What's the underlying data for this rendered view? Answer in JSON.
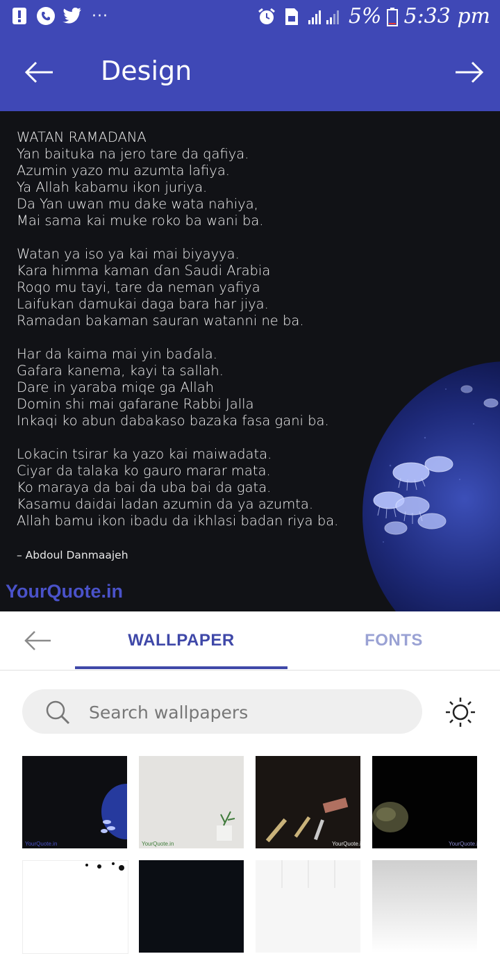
{
  "status_bar": {
    "battery_percent": "5%",
    "time": "5:33 pm",
    "overflow": "···"
  },
  "app_bar": {
    "title": "Design"
  },
  "quote": {
    "title": "WATAN RAMADANA",
    "stanzas": [
      [
        "Yan baituka na jero tare da qafiya.",
        "Azumin yazo mu azumta lafiya.",
        "Ya Allah kabamu ikon juriya.",
        "Da Yan uwan mu dake wata nahiya,",
        "Mai sama kai muke roko ba wani ba."
      ],
      [
        "Watan ya iso ya kai mai biyayya.",
        "Kara himma kaman ɗan Saudi Arabia",
        "Roqo mu tayi, tare da neman yafiya",
        "Laifukan damukai daga bara har jiya.",
        "Ramadan bakaman sauran watanni ne ba."
      ],
      [
        "Har da kaima mai yin baɗala.",
        "Gafara kanema, kayi ta sallah.",
        "Dare in yaraba miqe ga Allah",
        "Domin shi mai gafarane Rabbi Jalla",
        "Inkaqi ko abun dabakaso bazaka fasa gani ba."
      ],
      [
        "Lokacin tsirar ka yazo kai maiwadata.",
        "Ciyar da talaka ko gauro marar mata.",
        "Ko maraya da bai da uba bai da gata.",
        "Kasamu daidai ladan azumin da ya azumta.",
        "Allah bamu ikon ibadu da ikhlasi badan riya ba."
      ]
    ],
    "author": "– Abdoul Danmaajeh",
    "watermark": "YourQuote.in"
  },
  "tabs": {
    "wallpaper": "WALLPAPER",
    "fonts": "FONTS"
  },
  "search": {
    "placeholder": "Search wallpapers",
    "value": ""
  },
  "thumbnails": {
    "watermark": "YourQuote.in"
  },
  "colors": {
    "primary": "#3f48b6",
    "accent_tab": "#3f48a8",
    "inactive_tab": "#9aa2d4",
    "preview_bg": "#111216"
  }
}
